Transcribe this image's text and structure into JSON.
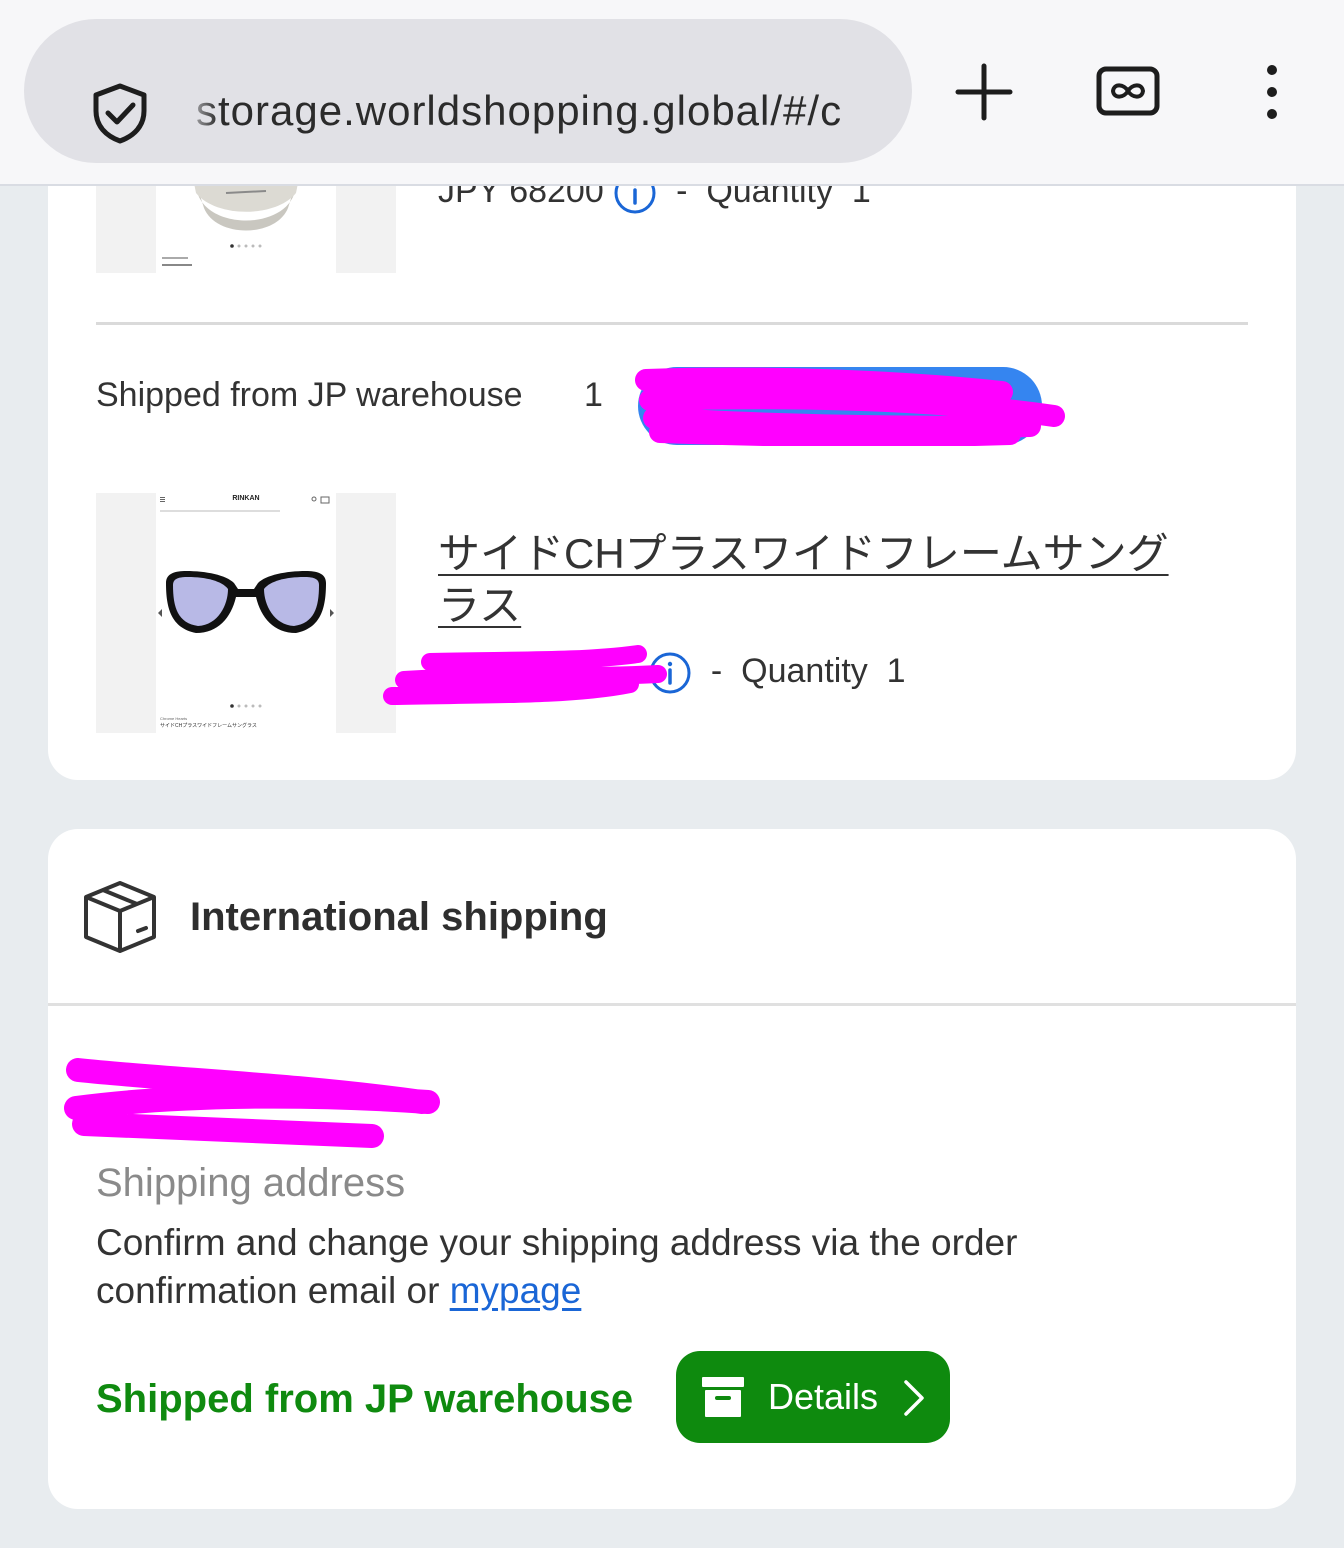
{
  "browser": {
    "url": "storage.worldshopping.global/#/c",
    "icons": {
      "security": "shield-check-icon",
      "new_tab": "plus-icon",
      "tab_switcher": "infinity-tabs-icon",
      "menu": "kebab-menu-icon"
    }
  },
  "items_card": {
    "item1": {
      "price_text": "JPY  68200",
      "sep": "-",
      "qty_label": "Quantity",
      "qty": "1"
    },
    "shipment": {
      "label": "Shipped from JP warehouse",
      "count": "1"
    },
    "item2": {
      "thumb_header": "RINKAN",
      "thumb_caption_brand": "Chrome Hearts",
      "thumb_caption_title": "サイドCHプラスワイドフレームサングラス",
      "title": "サイドCHプラスワイドフレームサングラス",
      "sep": "-",
      "qty_label": "Quantity",
      "qty": "1"
    }
  },
  "ship_card": {
    "icon": "package-box-icon",
    "title": "International shipping",
    "address_label": "Shipping address",
    "address_text": "Confirm and change your shipping address via the order confirmation email or ",
    "mypage_link": "mypage",
    "status": "Shipped from JP warehouse",
    "details_button": "Details"
  },
  "colors": {
    "accent_green": "#0e8a0e",
    "link_blue": "#1a66d6",
    "pill_blue": "#3585f0",
    "redaction": "#ff00ff"
  }
}
